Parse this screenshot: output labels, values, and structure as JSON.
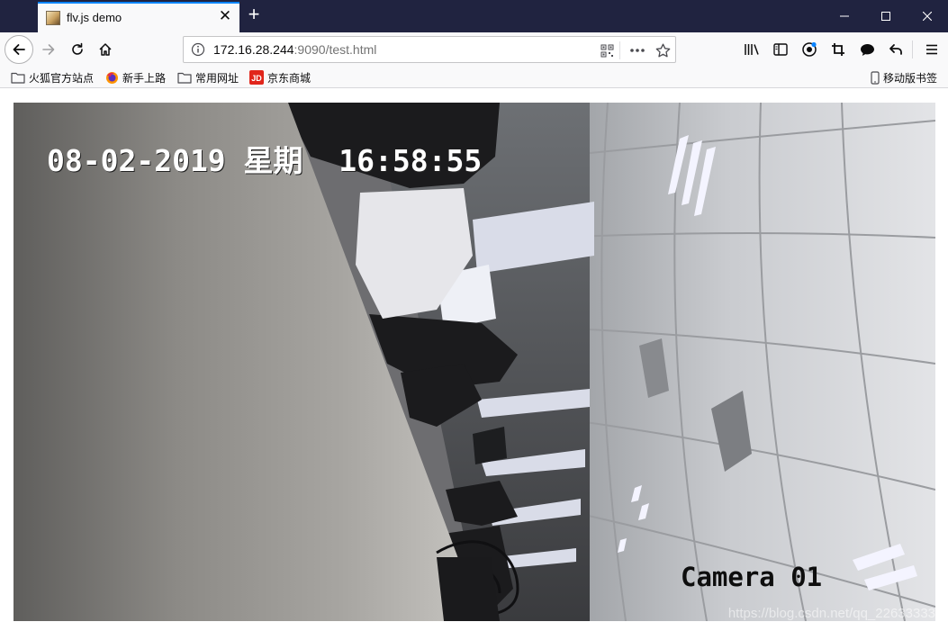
{
  "tab": {
    "title": "flv.js demo",
    "close_glyph": "✕",
    "favicon": "page-favicon"
  },
  "new_tab_glyph": "+",
  "window_controls": {
    "minimize": "minimize-icon",
    "maximize": "maximize-icon",
    "close": "close-icon"
  },
  "navbar": {
    "url_host": "172.16.28.244",
    "url_rest": ":9090/test.html"
  },
  "bookmarks": [
    {
      "label": "火狐官方站点",
      "icon": "folder-icon"
    },
    {
      "label": "新手上路",
      "icon": "firefox-icon"
    },
    {
      "label": "常用网址",
      "icon": "folder-icon"
    },
    {
      "label": "京东商城",
      "icon": "jd-icon"
    }
  ],
  "mobile_bookmarks": "移动版书签",
  "video": {
    "osd_datetime": "08-02-2019 星期  16:58:55",
    "osd_camera": "Camera 01",
    "watermark": "https://blog.csdn.net/qq_22633333"
  },
  "colors": {
    "titlebar": "#202340",
    "accent": "#0a84ff",
    "toolbar": "#f9f9fa"
  }
}
